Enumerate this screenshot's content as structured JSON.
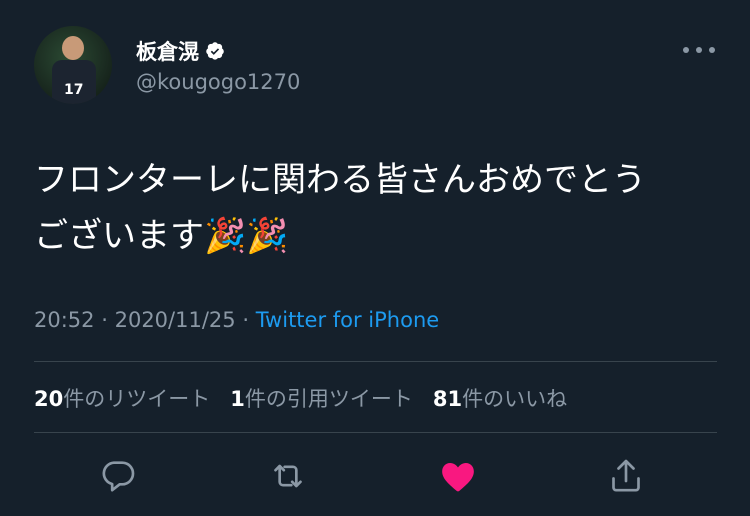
{
  "author": {
    "name": "板倉滉",
    "handle": "@kougogo1270",
    "avatar_jersey_number": "17"
  },
  "tweet": {
    "text_line1": "フロンターレに関わる皆さんおめでとう",
    "text_line2": "ございます",
    "emoji": "🎉🎉"
  },
  "meta": {
    "time": "20:52",
    "separator": "·",
    "date": "2020/11/25",
    "source": "Twitter for iPhone"
  },
  "stats": {
    "retweets_count": "20",
    "retweets_label": "件のリツイート",
    "quotes_count": "1",
    "quotes_label": "件の引用ツイート",
    "likes_count": "81",
    "likes_label": "件のいいね"
  },
  "colors": {
    "background": "#15202b",
    "secondary_text": "#8b98a5",
    "link": "#1d9bf0",
    "like": "#f91880",
    "divider": "#38444d"
  },
  "icons": [
    "verified-icon",
    "more-icon",
    "reply-icon",
    "retweet-icon",
    "like-icon",
    "share-icon"
  ]
}
